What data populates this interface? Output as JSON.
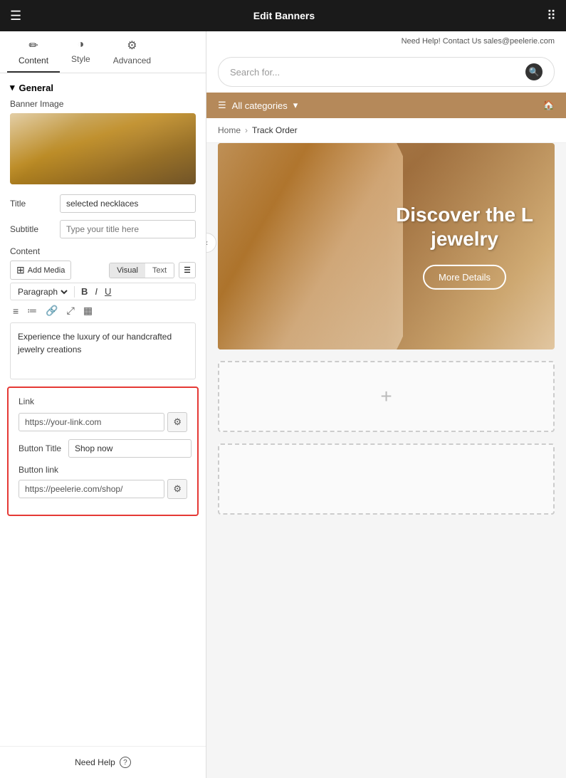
{
  "topbar": {
    "title": "Edit Banners",
    "help_text": "Need Help! Contact Us sales@peelerie.com"
  },
  "tabs": [
    {
      "id": "content",
      "label": "Content",
      "icon": "✏️",
      "active": true
    },
    {
      "id": "style",
      "label": "Style",
      "icon": "◑",
      "active": false
    },
    {
      "id": "advanced",
      "label": "Advanced",
      "icon": "⚙️",
      "active": false
    }
  ],
  "general": {
    "section_label": "General",
    "banner_image_label": "Banner Image",
    "title_label": "Title",
    "title_value": "selected necklaces",
    "subtitle_label": "Subtitle",
    "subtitle_placeholder": "Type your title here",
    "content_label": "Content"
  },
  "editor": {
    "add_media_label": "Add Media",
    "visual_label": "Visual",
    "text_label": "Text",
    "paragraph_option": "Paragraph",
    "content_text": "Experience the luxury of our handcrafted jewelry creations"
  },
  "link_section": {
    "link_label": "Link",
    "link_value": "https://your-link.com",
    "button_title_label": "Button Title",
    "button_title_value": "Shop now",
    "button_link_label": "Button link",
    "button_link_value": "https://peelerie.com/shop/"
  },
  "need_help": {
    "label": "Need Help"
  },
  "store": {
    "help_text": "Need Help! Contact Us sales@peelerie.com",
    "search_placeholder": "Search for...",
    "categories_label": "All categories",
    "home_icon": "🏠",
    "breadcrumb_home": "Home",
    "breadcrumb_current": "Track Order",
    "banner_heading_line1": "Discover the L",
    "banner_heading_line2": "jewelry",
    "banner_btn": "More Details"
  },
  "colors": {
    "topbar_bg": "#1a1a1a",
    "categories_bg": "#b5895a",
    "accent_red": "#e53935"
  }
}
